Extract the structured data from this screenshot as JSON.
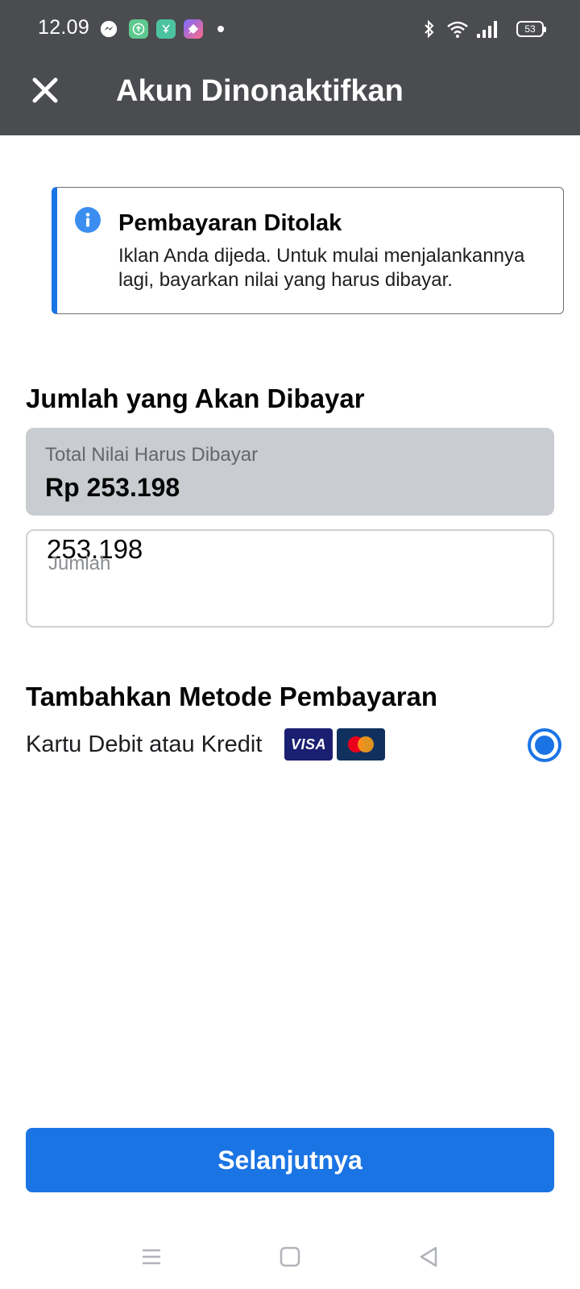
{
  "status_bar": {
    "time": "12.09",
    "battery": "53",
    "notif_colors": [
      "#5ec98f",
      "#4cc3a0",
      "#7a6cff"
    ]
  },
  "app_bar": {
    "title": "Akun Dinonaktifkan",
    "close_icon": "close-icon"
  },
  "banner": {
    "title": "Pembayaran Ditolak",
    "text": "Iklan Anda dijeda. Untuk mulai menjalankannya lagi, bayarkan nilai yang harus dibayar.",
    "icon": "info-icon",
    "accent": "#1b74e4"
  },
  "amount_section": {
    "heading": "Jumlah yang Akan Dibayar",
    "total_label": "Total Nilai Harus Dibayar",
    "total_value": "Rp 253.198",
    "amount_value": "253.198",
    "amount_label": "Jumlah"
  },
  "payment_section": {
    "heading": "Tambahkan Metode Pembayaran",
    "method_label": "Kartu Debit atau Kredit",
    "card_brands": [
      "VISA",
      "mastercard"
    ],
    "selected": true
  },
  "next_button": {
    "label": "Selanjutnya"
  },
  "nav_bar": {
    "icons": [
      "menu-icon",
      "home-icon",
      "back-icon"
    ]
  }
}
